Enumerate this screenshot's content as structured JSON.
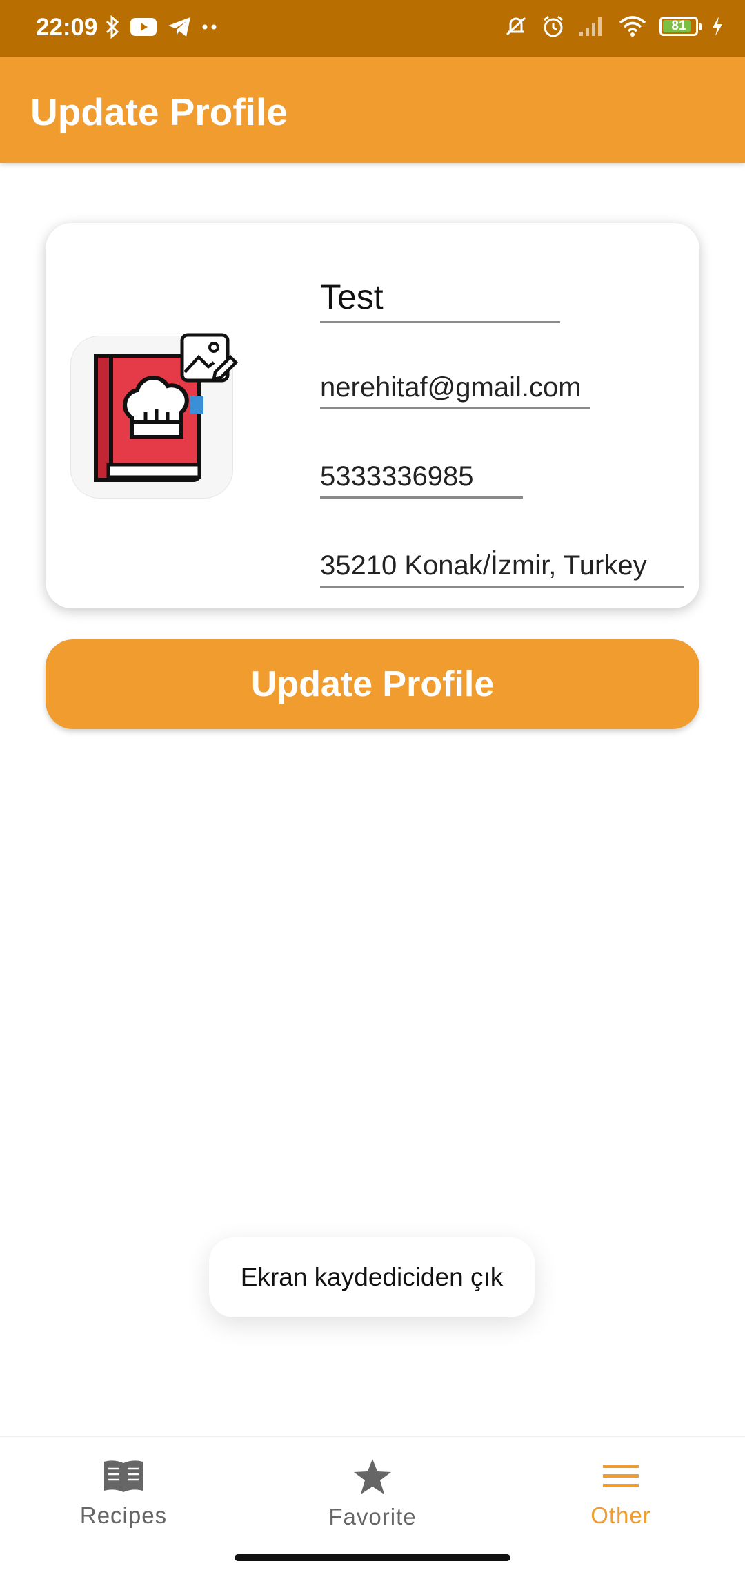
{
  "status_bar": {
    "time": "22:09",
    "battery": "81",
    "icons": [
      "bluetooth-icon",
      "youtube-icon",
      "telegram-icon",
      "more-dots-icon",
      "mute-icon",
      "alarm-icon",
      "signal-icon",
      "wifi-icon",
      "battery-icon",
      "charging-icon"
    ]
  },
  "app_bar": {
    "title": "Update Profile"
  },
  "profile": {
    "name": "Test",
    "email": "nerehitaf@gmail.com",
    "phone": "5333336985",
    "address": "35210 Konak/İzmir, Turkey",
    "avatar_icon": "recipe-book-icon",
    "edit_image_icon": "edit-image-icon"
  },
  "update_button": {
    "label": "Update Profile"
  },
  "toast": {
    "text": "Ekran kaydediciden çık"
  },
  "bottom_nav": {
    "items": [
      {
        "label": "Recipes",
        "icon": "book-icon",
        "active": false
      },
      {
        "label": "Favorite",
        "icon": "star-icon",
        "active": false
      },
      {
        "label": "Other",
        "icon": "menu-icon",
        "active": true
      }
    ]
  },
  "colors": {
    "primary": "#F09C2F",
    "status_bar": "#B86E00",
    "nav_inactive": "#666666"
  }
}
